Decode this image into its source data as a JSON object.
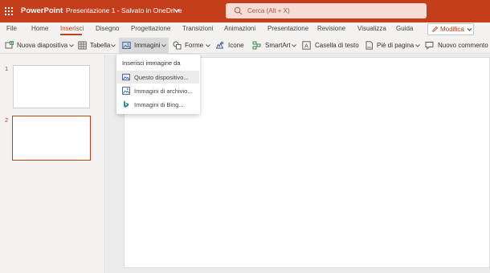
{
  "title_bar": {
    "app_name": "PowerPoint",
    "doc_title": "Presentazione 1 - Salvato in OneDrive",
    "search_placeholder": "Cerca (Alt + X)",
    "accent_color": "#c43e1c"
  },
  "tabs": [
    {
      "label": "File"
    },
    {
      "label": "Home"
    },
    {
      "label": "Inserisci",
      "active": true
    },
    {
      "label": "Disegno"
    },
    {
      "label": "Progettazione"
    },
    {
      "label": "Transizioni"
    },
    {
      "label": "Animazioni"
    },
    {
      "label": "Presentazione"
    },
    {
      "label": "Revisione"
    },
    {
      "label": "Visualizza"
    },
    {
      "label": "Guida"
    }
  ],
  "mode_button": {
    "label": "Modifica"
  },
  "ribbon": {
    "new_slide": "Nuova diapositiva",
    "table": "Tabella",
    "images": "Immagini",
    "shapes": "Forme",
    "icons": "Icone",
    "smartart": "SmartArt",
    "textbox": "Casella di testo",
    "footer": "Piè di pagina",
    "new_comment": "Nuovo commento"
  },
  "slides": [
    {
      "number": "1"
    },
    {
      "number": "2",
      "selected": true
    }
  ],
  "images_menu": {
    "heading": "Inserisci immagine da",
    "items": [
      {
        "label": "Questo dispositivo...",
        "icon": "image-device-icon"
      },
      {
        "label": "Immagini di archivio...",
        "icon": "stock-images-icon"
      },
      {
        "label": "Immagini di Bing...",
        "icon": "bing-icon"
      }
    ]
  }
}
